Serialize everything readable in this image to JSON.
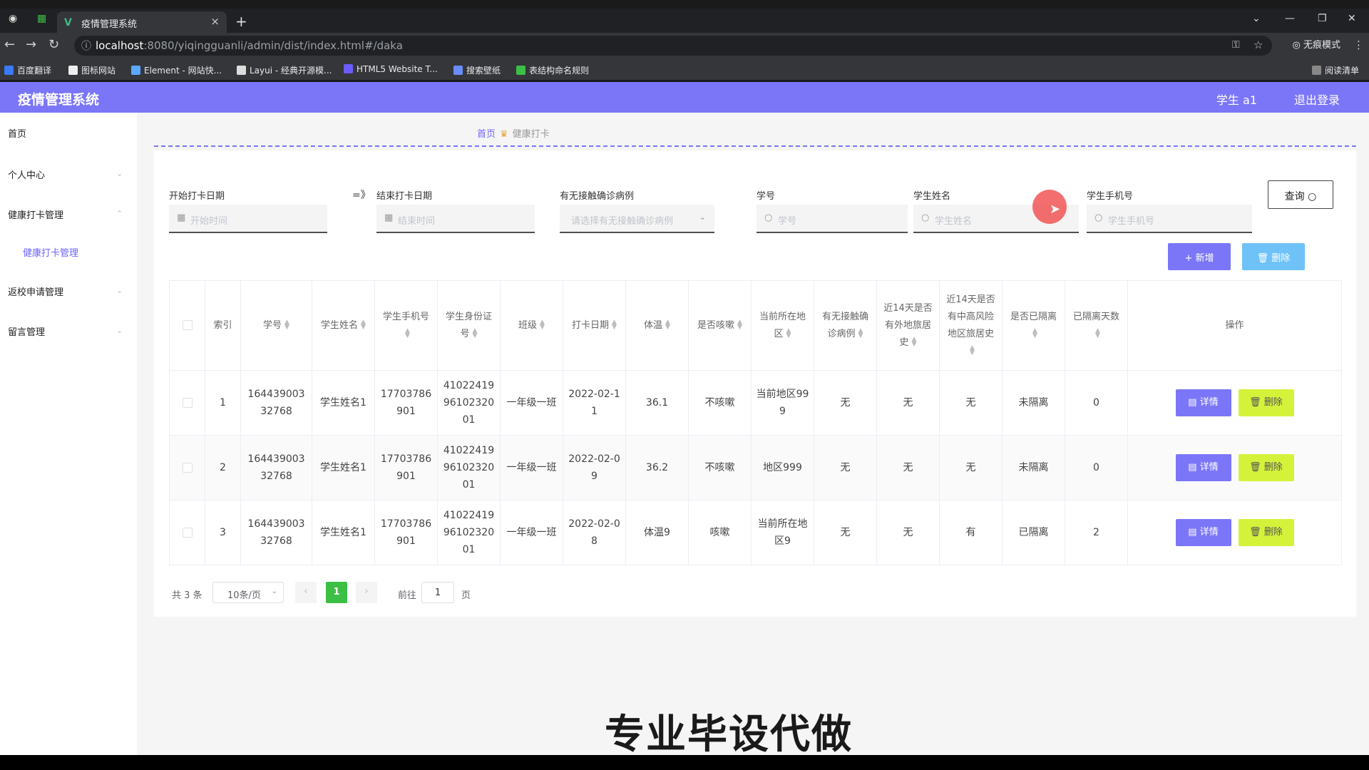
{
  "browser": {
    "tab_title": "疫情管理系统",
    "tab_close": "×",
    "new_tab": "+",
    "url_host": "localhost",
    "url_path": ":8080/yiqingguanli/admin/dist/index.html#/daka",
    "incognito": "无痕模式",
    "reading_list": "阅读清单",
    "bookmarks": [
      "百度翻译",
      "图标网站",
      "Element - 网站快...",
      "Layui - 经典开源模...",
      "HTML5 Website T...",
      "搜索壁纸",
      "表结构命名规则"
    ]
  },
  "header": {
    "title": "疫情管理系统",
    "user": "学生 a1",
    "logout": "退出登录"
  },
  "sidebar": {
    "items": [
      {
        "label": "首页"
      },
      {
        "label": "个人中心"
      },
      {
        "label": "健康打卡管理"
      },
      {
        "label": "返校申请管理"
      },
      {
        "label": "留言管理"
      }
    ],
    "sub_label": "健康打卡管理"
  },
  "breadcrumb": {
    "home": "首页",
    "sep": "♛",
    "current": "健康打卡"
  },
  "filters": {
    "start_label": "开始打卡日期",
    "start_placeholder": "开始时间",
    "range_sep": "=》",
    "end_label": "结束打卡日期",
    "end_placeholder": "结束时间",
    "contact_label": "有无接触确诊病例",
    "contact_placeholder": "请选择有无接触确诊病例",
    "sid_label": "学号",
    "sid_placeholder": "学号",
    "name_label": "学生姓名",
    "name_placeholder": "学生姓名",
    "phone_label": "学生手机号",
    "phone_placeholder": "学生手机号",
    "query": "查询 ○"
  },
  "actions": {
    "add": "+ 新增",
    "delete": "🗑 删除"
  },
  "table": {
    "headers": [
      "索引",
      "学号",
      "学生姓名",
      "学生手机号",
      "学生身份证号",
      "班级",
      "打卡日期",
      "体温",
      "是否咳嗽",
      "当前所在地区",
      "有无接触确诊病例",
      "近14天是否有外地旅居史",
      "近14天是否有中高风险地区旅居史",
      "是否已隔离",
      "已隔离天数",
      "操作"
    ],
    "rows": [
      [
        "1",
        "16443900332768",
        "学生姓名1",
        "17703786901",
        "410224199610232001",
        "一年级一班",
        "2022-02-11",
        "36.1",
        "不咳嗽",
        "当前地区999",
        "无",
        "无",
        "无",
        "未隔离",
        "0"
      ],
      [
        "2",
        "16443900332768",
        "学生姓名1",
        "17703786901",
        "410224199610232001",
        "一年级一班",
        "2022-02-09",
        "36.2",
        "不咳嗽",
        "地区999",
        "无",
        "无",
        "无",
        "未隔离",
        "0"
      ],
      [
        "3",
        "16443900332768",
        "学生姓名1",
        "17703786901",
        "410224199610232001",
        "一年级一班",
        "2022-02-08",
        "体温9",
        "咳嗽",
        "当前所在地区9",
        "无",
        "无",
        "有",
        "已隔离",
        "2"
      ]
    ],
    "detail_label": "▤ 详情",
    "delete_label": "🗑 删除"
  },
  "pagination": {
    "total": "共 3 条",
    "page_size": "10条/页",
    "current": "1",
    "goto": "前往",
    "goto_value": "1",
    "page_unit": "页"
  },
  "watermark": "专业毕设代做"
}
